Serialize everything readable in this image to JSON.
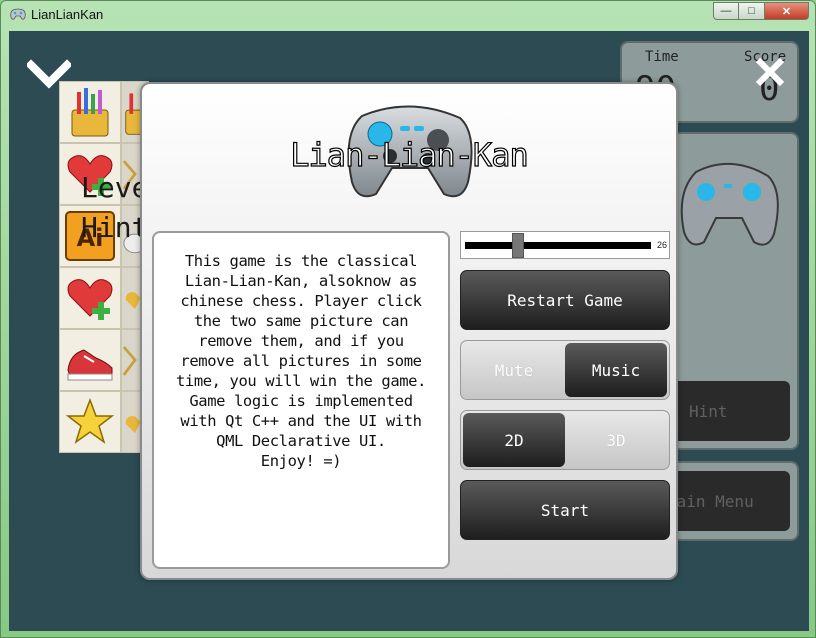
{
  "window": {
    "title": "LianLianKan",
    "min_symbol": "—",
    "max_symbol": "□",
    "close_symbol": "✕"
  },
  "background": {
    "time_label": "Time",
    "score_label": "Score",
    "time_value": "90",
    "score_value": "0",
    "level_text": "Level: 1",
    "hint_count_text": "Hint: 3",
    "hint_button": "Hint",
    "main_menu_button": "Main Menu",
    "tiles": [
      "pencil-cup",
      "pencil-cup-partial",
      "heart-plus",
      "star-partial",
      "ai-logo",
      "sneaker-partial",
      "heart-plus",
      "heart-partial",
      "sneaker",
      "star-partial",
      "star",
      "heart-partial"
    ]
  },
  "dialog": {
    "title": "Lian-Lian-Kan",
    "about_text": "This game is the classical\nLian-Lian-Kan, alsoknow as\nchinese chess. Player click\nthe two same picture can\nremove them, and if you\nremove all pictures in some\ntime, you will win the game.\nGame logic is implemented\nwith Qt C++ and the UI with\nQML Declarative UI.\nEnjoy! =)",
    "slider_value": "26",
    "slider_level": 0.26,
    "restart_button": "Restart Game",
    "mute_label": "Mute",
    "music_label": "Music",
    "sound_selected": "Music",
    "view_2d_label": "2D",
    "view_3d_label": "3D",
    "view_selected": "2D",
    "start_button": "Start"
  },
  "icons": {
    "confirm": "checkmark-icon",
    "close": "close-icon",
    "logo": "gamepad-icon"
  },
  "colors": {
    "window_frame": "#8fd08f",
    "client_bg": "#2c4b52",
    "panel_bg": "#8d9c9a",
    "button_dark": "#1e1e1e",
    "gamepad_accent": "#29b6e8"
  }
}
